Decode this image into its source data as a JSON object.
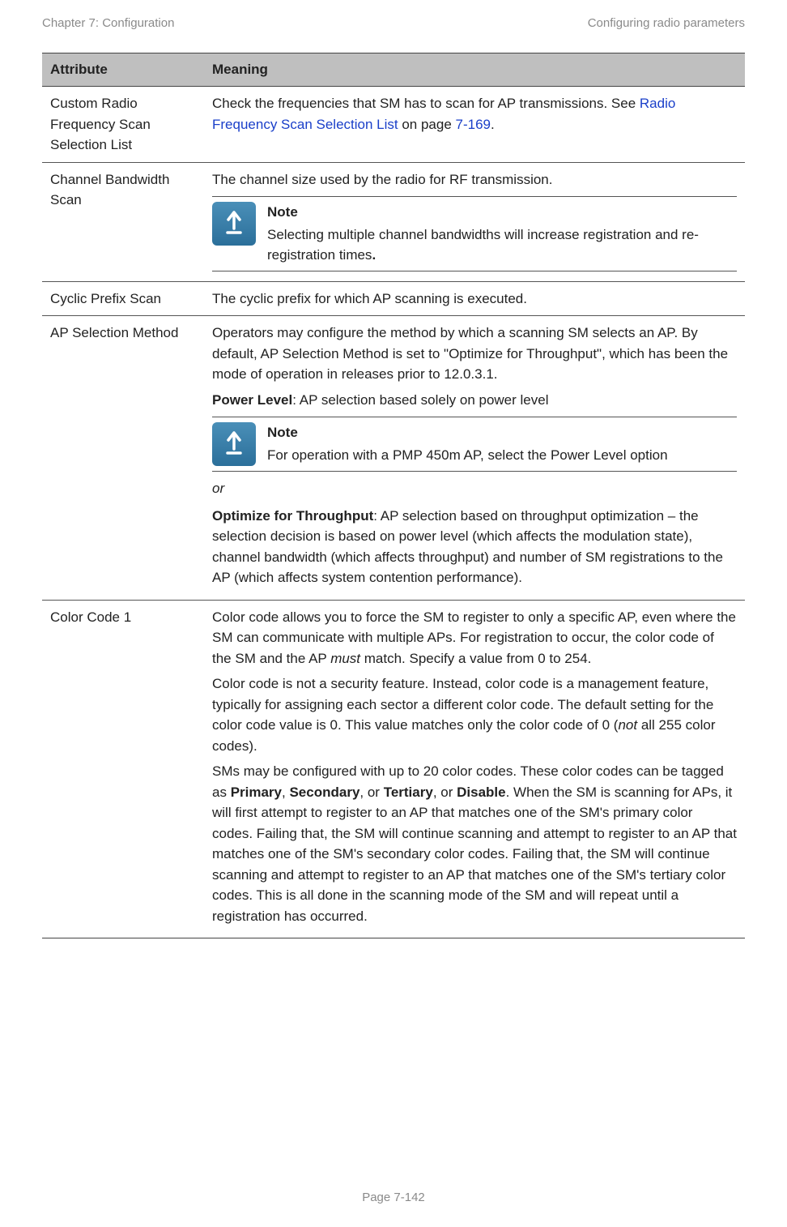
{
  "header": {
    "left": "Chapter 7:  Configuration",
    "right": "Configuring radio parameters"
  },
  "table": {
    "head_attr": "Attribute",
    "head_meaning": "Meaning"
  },
  "rows": {
    "r1": {
      "attr": "Custom Radio Frequency Scan Selection List",
      "text_prefix": "Check the frequencies that SM has to scan for AP transmissions. See ",
      "link": "Radio Frequency Scan Selection List",
      "text_mid": " on page ",
      "page_link": "7-169",
      "text_suffix": "."
    },
    "r2": {
      "attr": "Channel Bandwidth Scan",
      "top": "The channel size used by the radio for RF transmission.",
      "note_title": "Note",
      "note_body_a": "Selecting multiple channel bandwidths will increase registration and re-registration times",
      "note_body_b": "."
    },
    "r3": {
      "attr": "Cyclic Prefix Scan",
      "text": "The cyclic prefix for which AP scanning is executed."
    },
    "r4": {
      "attr": "AP Selection Method",
      "p1": "Operators may configure the method by which a scanning SM selects an AP. By default, AP Selection Method is set to \"Optimize for Throughput\", which has been the mode of operation in releases prior to 12.0.3.1.",
      "p2_label": "Power Level",
      "p2_rest": ": AP selection based solely on power level",
      "note_title": "Note",
      "note_body": "For operation with a PMP 450m AP, select the Power Level option",
      "or": "or",
      "p3_label": "Optimize for Throughput",
      "p3_rest": ": AP selection based on throughput optimization – the selection decision is based on power level (which affects the modulation state), channel bandwidth (which affects throughput) and number of SM registrations to the AP (which affects system contention performance)."
    },
    "r5": {
      "attr": "Color Code 1",
      "p1a": "Color code allows you to force the SM to register to only a specific AP, even where the SM can communicate with multiple APs. For registration to occur, the color code of the SM and the AP ",
      "p1_em": "must",
      "p1b": " match. Specify a value from 0 to 254.",
      "p2a": "Color code is not a security feature. Instead, color code is a management feature, typically for assigning each sector a different color code. The default setting for the color code value is 0. This value matches only the color code of 0 (",
      "p2_em": "not",
      "p2b": " all 255 color codes).",
      "p3a": "SMs may be configured with up to 20 color codes. These color codes can be tagged as ",
      "p3_b1": "Primary",
      "p3_s1": ", ",
      "p3_b2": "Secondary",
      "p3_s2": ", or ",
      "p3_b3": "Tertiary",
      "p3_s3": ", or ",
      "p3_b4": "Disable",
      "p3b": ". When the SM is scanning for APs, it will first attempt to register to an AP that matches one of the SM's primary color codes. Failing that, the SM will continue scanning and attempt to register to an AP that matches one of the SM's secondary color codes. Failing that, the SM will continue scanning and attempt to register to an AP that matches one of the SM's tertiary color codes. This is all done in the scanning mode of the SM and will repeat until a registration has occurred."
    }
  },
  "footer": {
    "page": "Page 7-142"
  }
}
